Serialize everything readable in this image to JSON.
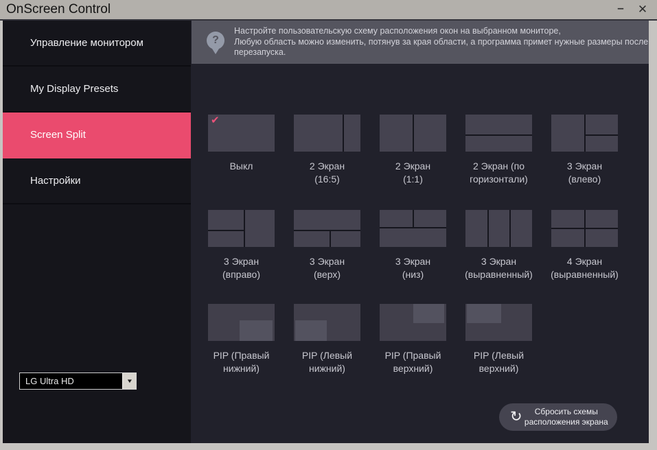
{
  "window": {
    "title": "OnScreen Control"
  },
  "icons": {
    "minimize": "–",
    "close": "✕",
    "help": "?",
    "check": "✔",
    "refresh": "↻",
    "dropdown_arrow": "▼"
  },
  "colors": {
    "accent_pink": "#ea4b6e",
    "titlebar_bg": "#b3b0ab",
    "sidebar_bg": "#15151b",
    "main_bg": "#21212b",
    "banner_bg": "#55555f",
    "thumb_gray": "#454350",
    "pip_base": "#413f4b",
    "pip_inset": "#53525f"
  },
  "sidebar": {
    "items": [
      {
        "label": "Управление монитором",
        "selected": false
      },
      {
        "label": "My Display Presets",
        "selected": false
      },
      {
        "label": "Screen Split",
        "selected": true
      },
      {
        "label": "Настройки",
        "selected": false
      }
    ],
    "monitor_select": {
      "value": "LG Ultra HD"
    }
  },
  "banner": {
    "lines": [
      "Настройте пользовательскую схему расположения окон на выбранном мониторе,",
      "Любую область можно изменить, потянув за края области, а программа примет нужные размеры после",
      "перезапуска."
    ]
  },
  "layouts": {
    "items": [
      {
        "name": "off",
        "label_lines": [
          "Выкл"
        ],
        "selected": true
      },
      {
        "name": "2-screen-16-5",
        "label_lines": [
          "2 Экран",
          "(16:5)"
        ]
      },
      {
        "name": "2-screen-1-1",
        "label_lines": [
          "2 Экран",
          "(1:1)"
        ]
      },
      {
        "name": "2-screen-horizontal",
        "label_lines": [
          "2 Экран (по",
          "горизонтали)"
        ]
      },
      {
        "name": "3-screen-left",
        "label_lines": [
          "3 Экран",
          "(влево)"
        ]
      },
      {
        "name": "3-screen-right",
        "label_lines": [
          "3 Экран",
          "(вправо)"
        ]
      },
      {
        "name": "3-screen-top",
        "label_lines": [
          "3 Экран",
          "(верх)"
        ]
      },
      {
        "name": "3-screen-bottom",
        "label_lines": [
          "3 Экран",
          "(низ)"
        ]
      },
      {
        "name": "3-screen-even",
        "label_lines": [
          "3 Экран",
          "(выравненный)"
        ]
      },
      {
        "name": "4-screen-even",
        "label_lines": [
          "4 Экран",
          "(выравненный)"
        ]
      },
      {
        "name": "pip-bottom-right",
        "label_lines": [
          "PIP (Правый",
          "нижний)"
        ]
      },
      {
        "name": "pip-bottom-left",
        "label_lines": [
          "PIP (Левый",
          "нижний)"
        ]
      },
      {
        "name": "pip-top-right",
        "label_lines": [
          "PIP (Правый",
          "верхний)"
        ]
      },
      {
        "name": "pip-top-left",
        "label_lines": [
          "PIP (Левый",
          "верхний)"
        ]
      }
    ]
  },
  "reset_button": {
    "lines": [
      "Сбросить схемы",
      "расположения экрана"
    ]
  }
}
